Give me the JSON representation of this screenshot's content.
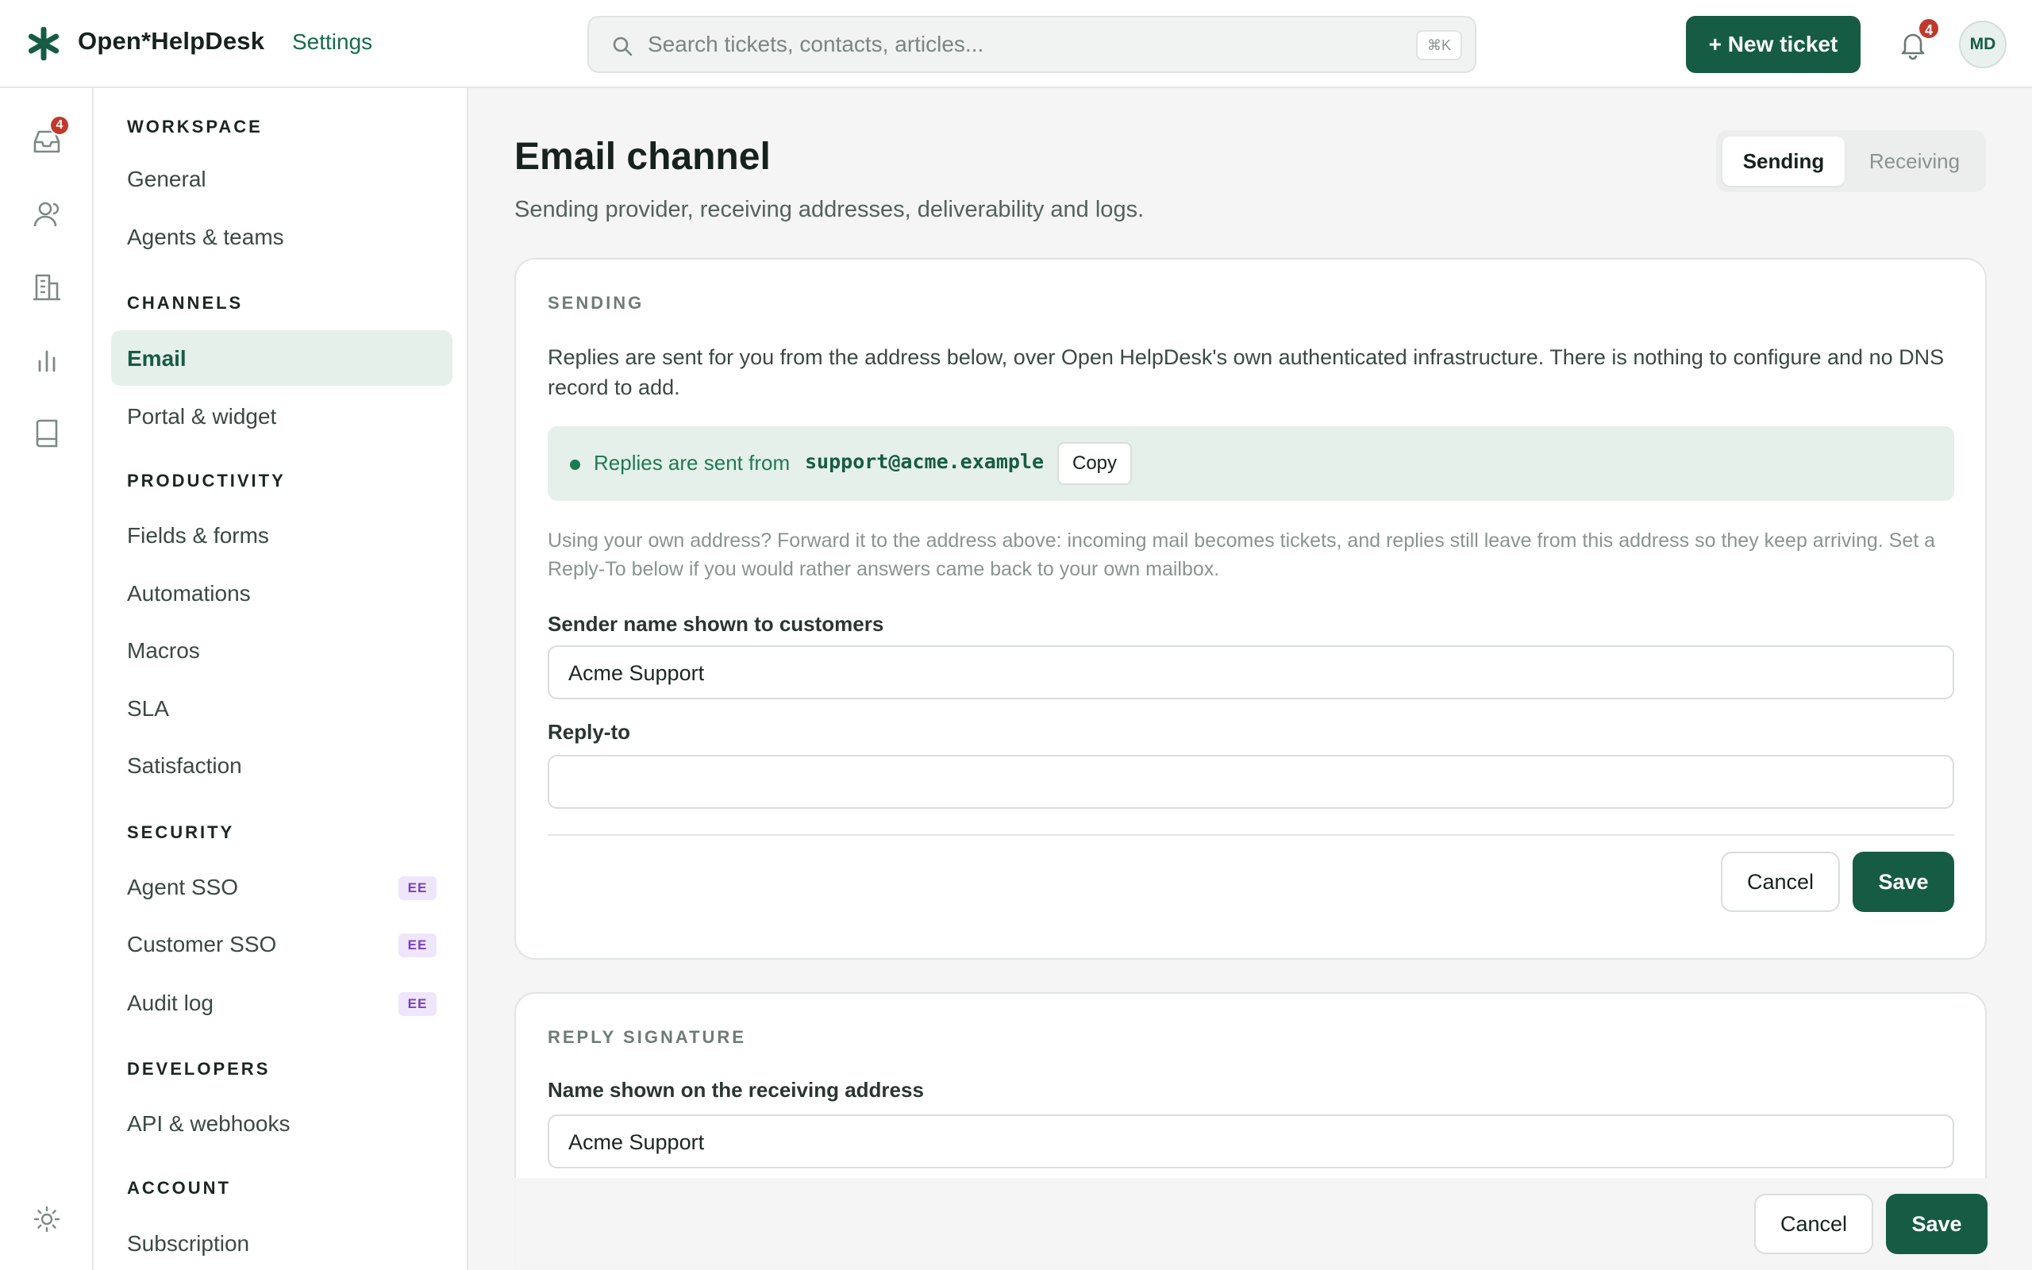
{
  "app": {
    "name": "Open*HelpDesk",
    "breadcrumb": "Settings"
  },
  "search": {
    "placeholder": "Search tickets, contacts, articles...",
    "shortcut": "⌘K"
  },
  "header": {
    "new_ticket_label": "+ New ticket",
    "notifications_count": "4",
    "avatar_initials": "MD"
  },
  "rail": {
    "inbox_badge": "4",
    "icons": [
      "inbox-icon",
      "contacts-icon",
      "companies-icon",
      "reports-icon",
      "knowledge-base-icon",
      "theme-toggle-icon"
    ]
  },
  "sidebar": {
    "sections": [
      {
        "title": "WORKSPACE",
        "items": [
          {
            "label": "General"
          },
          {
            "label": "Agents & teams"
          }
        ]
      },
      {
        "title": "CHANNELS",
        "items": [
          {
            "label": "Email",
            "active": true
          },
          {
            "label": "Portal & widget"
          }
        ]
      },
      {
        "title": "PRODUCTIVITY",
        "items": [
          {
            "label": "Fields & forms"
          },
          {
            "label": "Automations"
          },
          {
            "label": "Macros"
          },
          {
            "label": "SLA"
          },
          {
            "label": "Satisfaction"
          }
        ]
      },
      {
        "title": "SECURITY",
        "items": [
          {
            "label": "Agent SSO",
            "badge": "EE"
          },
          {
            "label": "Customer SSO",
            "badge": "EE"
          },
          {
            "label": "Audit log",
            "badge": "EE"
          }
        ]
      },
      {
        "title": "DEVELOPERS",
        "items": [
          {
            "label": "API & webhooks"
          }
        ]
      },
      {
        "title": "ACCOUNT",
        "items": [
          {
            "label": "Subscription"
          }
        ]
      }
    ]
  },
  "main": {
    "title": "Email channel",
    "subtitle": "Sending provider, receiving addresses, deliverability and logs.",
    "tabs": [
      {
        "label": "Sending",
        "selected": true
      },
      {
        "label": "Receiving",
        "selected": false
      }
    ],
    "sending": {
      "heading": "SENDING",
      "description": "Replies are sent for you from the address below, over Open HelpDesk's own authenticated infrastructure. There is nothing to configure and no DNS record to add.",
      "banner_text": "Replies are sent from",
      "address": "support@acme.example",
      "copy_label": "Copy",
      "note": "Using your own address? Forward it to the address above: incoming mail becomes tickets, and replies still leave from this address so they keep arriving. Set a Reply-To below if you would rather answers came back to your own mailbox.",
      "sender_name_label": "Sender name shown to customers",
      "sender_name_value": "Acme Support",
      "reply_to_label": "Reply-to",
      "reply_to_value": "",
      "cancel_label": "Cancel",
      "save_label": "Save"
    },
    "signature": {
      "heading": "REPLY SIGNATURE",
      "name_label": "Name shown on the receiving address",
      "name_value": "Acme Support"
    }
  },
  "footer": {
    "cancel_label": "Cancel",
    "save_label": "Save"
  },
  "colors": {
    "accent": "#165c44",
    "badge_red": "#c0392b",
    "ee_badge": "#7a3fc7"
  }
}
